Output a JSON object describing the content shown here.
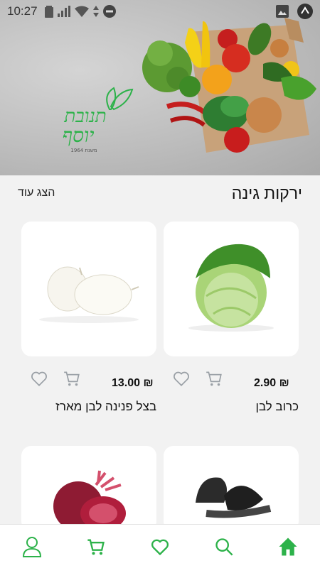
{
  "status_bar": {
    "time": "10:27"
  },
  "brand": {
    "logo_line1": "תנובת",
    "logo_line2": "יוסף",
    "logo_since": "משנת 1964"
  },
  "section": {
    "title": "ירקות גינה",
    "show_more": "הצג עוד"
  },
  "products": [
    {
      "name": "כרוב לבן",
      "price": "2.90 ₪",
      "image": "white-cabbage"
    },
    {
      "name": "בצל פנינה לבן מארז",
      "price": "13.00 ₪",
      "image": "white-pearl-onions"
    },
    {
      "name": "",
      "price": "",
      "image": "black-radish"
    },
    {
      "name": "",
      "price": "",
      "image": "red-beet"
    }
  ],
  "colors": {
    "brand_green": "#2db24a",
    "icon_gray": "#9aa0a6"
  },
  "bottom_nav": [
    "profile-icon",
    "cart-icon",
    "heart-icon",
    "search-icon",
    "home-icon"
  ]
}
